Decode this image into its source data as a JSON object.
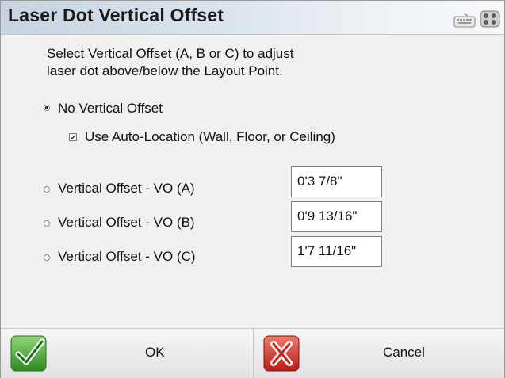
{
  "dialog": {
    "title": "Laser Dot Vertical Offset",
    "header_icons": [
      "keyboard-icon",
      "gamepad-icon"
    ],
    "instructions": [
      "Select Vertical Offset (A, B or C) to adjust",
      "laser dot above/below the Layout Point."
    ],
    "options": {
      "no_offset": {
        "label": "No Vertical Offset",
        "selected": true
      },
      "auto_location": {
        "label": "Use Auto-Location  (Wall, Floor, or Ceiling)",
        "checked": true
      },
      "offsets": [
        {
          "label": "Vertical Offset - VO (A)",
          "value": "0'3 7/8\"",
          "selected": false
        },
        {
          "label": "Vertical Offset - VO (B)",
          "value": "0'9 13/16\"",
          "selected": false
        },
        {
          "label": "Vertical Offset - VO (C)",
          "value": "1'7 11/16\"",
          "selected": false
        }
      ]
    },
    "buttons": {
      "ok_label": "OK",
      "ok_icon": "green-checkmark-icon",
      "cancel_label": "Cancel",
      "cancel_icon": "red-x-icon"
    },
    "colors": {
      "ok_green": "#3ca32c",
      "cancel_red": "#d9322a",
      "title_gradient_start": "#c6d4e0"
    }
  }
}
